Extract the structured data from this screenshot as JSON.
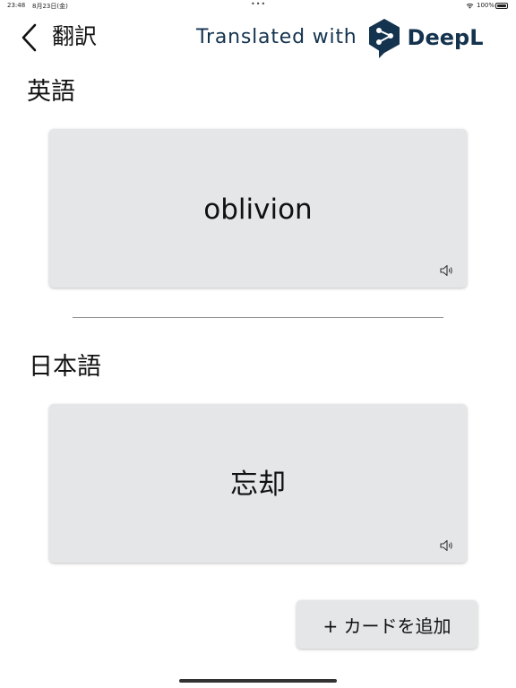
{
  "status_bar": {
    "time": "23:48",
    "date": "8月23日(金)",
    "battery": "100%",
    "icons": [
      "wifi-icon",
      "battery-icon"
    ]
  },
  "nav": {
    "title": "翻訳",
    "back_icon": "chevron-left-icon"
  },
  "credit": {
    "text": "Translated with",
    "brand": "DeepL",
    "brand_color": "#14334f"
  },
  "source": {
    "language_label": "英語",
    "word": "oblivion",
    "speaker_icon": "speaker-icon"
  },
  "target": {
    "language_label": "日本語",
    "word": "忘却",
    "speaker_icon": "speaker-icon"
  },
  "actions": {
    "add_card_label": "+ カードを追加"
  },
  "colors": {
    "card_bg": "#e5e6e7",
    "divider": "#8a8a8a"
  }
}
